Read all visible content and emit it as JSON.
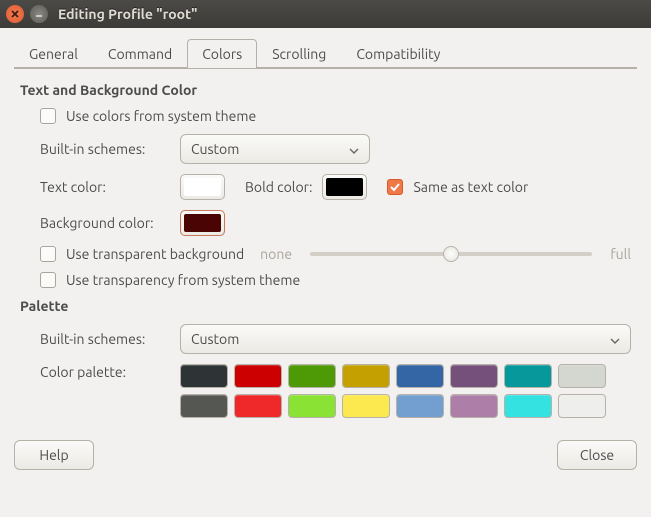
{
  "window": {
    "title": "Editing Profile \"root\""
  },
  "tabs": [
    "General",
    "Command",
    "Colors",
    "Scrolling",
    "Compatibility"
  ],
  "activeTab": 2,
  "section1": {
    "title": "Text and Background Color",
    "useSystem": {
      "label": "Use colors from system theme",
      "checked": false
    },
    "schemeLabel": "Built-in schemes:",
    "schemeValue": "Custom",
    "textColorLabel": "Text color:",
    "textColor": "#ffffff",
    "boldColorLabel": "Bold color:",
    "boldColor": "#000000",
    "sameAsText": {
      "label": "Same as text color",
      "checked": true
    },
    "bgLabel": "Background color:",
    "bgColor": "#4a0404",
    "transparentBg": {
      "label": "Use transparent background",
      "checked": false
    },
    "sliderMin": "none",
    "sliderMax": "full",
    "sliderPos": 50,
    "useSysTrans": {
      "label": "Use transparency from system theme",
      "checked": false
    }
  },
  "section2": {
    "title": "Palette",
    "schemeLabel": "Built-in schemes:",
    "schemeValue": "Custom",
    "paletteLabel": "Color palette:",
    "colors": [
      "#2e3436",
      "#cc0000",
      "#4e9a06",
      "#c4a000",
      "#3465a4",
      "#75507b",
      "#06989a",
      "#d3d7cf",
      "#555753",
      "#ef2929",
      "#8ae234",
      "#fce94f",
      "#729fcf",
      "#ad7fa8",
      "#34e2e2",
      "#eeeeec"
    ]
  },
  "footer": {
    "help": "Help",
    "close": "Close"
  }
}
